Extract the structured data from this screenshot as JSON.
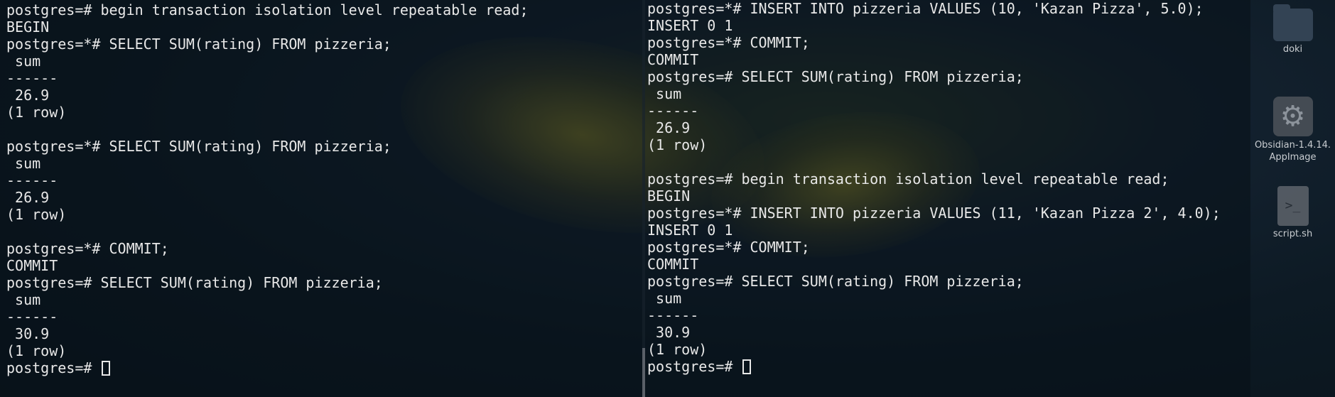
{
  "terminal_left": {
    "lines": [
      "postgres=# begin transaction isolation level repeatable read;",
      "BEGIN",
      "postgres=*# SELECT SUM(rating) FROM pizzeria;",
      " sum",
      "------",
      " 26.9",
      "(1 row)",
      "",
      "postgres=*# SELECT SUM(rating) FROM pizzeria;",
      " sum",
      "------",
      " 26.9",
      "(1 row)",
      "",
      "postgres=*# COMMIT;",
      "COMMIT",
      "postgres=# SELECT SUM(rating) FROM pizzeria;",
      " sum",
      "------",
      " 30.9",
      "(1 row)",
      ""
    ],
    "prompt": "postgres=# "
  },
  "terminal_right": {
    "lines": [
      "postgres=*# INSERT INTO pizzeria VALUES (10, 'Kazan Pizza', 5.0);",
      "INSERT 0 1",
      "postgres=*# COMMIT;",
      "COMMIT",
      "postgres=# SELECT SUM(rating) FROM pizzeria;",
      " sum",
      "------",
      " 26.9",
      "(1 row)",
      "",
      "postgres=# begin transaction isolation level repeatable read;",
      "BEGIN",
      "postgres=*# INSERT INTO pizzeria VALUES (11, 'Kazan Pizza 2', 4.0);",
      "INSERT 0 1",
      "postgres=*# COMMIT;",
      "COMMIT",
      "postgres=# SELECT SUM(rating) FROM pizzeria;",
      " sum",
      "------",
      " 30.9",
      "(1 row)",
      ""
    ],
    "prompt": "postgres=# "
  },
  "desktop": {
    "icons": [
      {
        "label": "doki",
        "icon": "folder-icon"
      },
      {
        "label": "Obsidian-1.4.14.\nAppImage",
        "icon": "gear-icon"
      },
      {
        "label": "script.sh",
        "icon": "script-file-icon"
      }
    ]
  },
  "colors": {
    "terminal_text": "#e8e8e8",
    "background": "#0d1a24",
    "flower_accent": "#d2be28"
  }
}
